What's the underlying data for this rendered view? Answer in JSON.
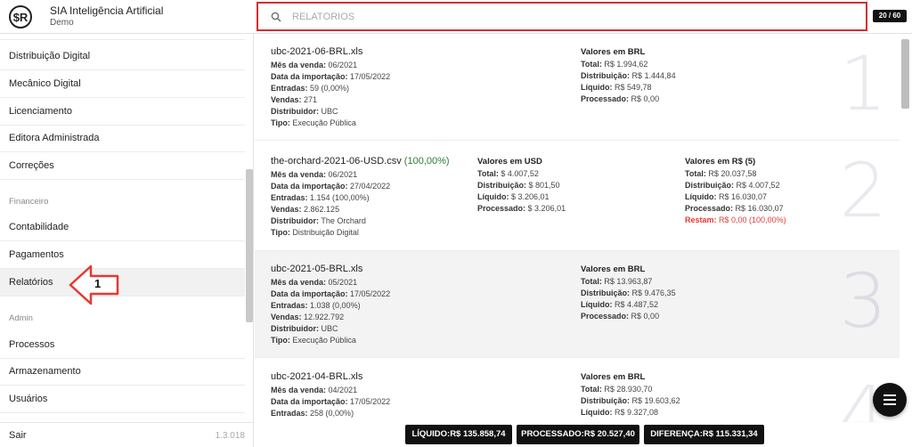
{
  "header": {
    "logo_text": "$R",
    "app_title": "SIA Inteligência Artificial",
    "app_subtitle": "Demo",
    "search_placeholder": "RELATÓRIOS",
    "page_counter": "20 / 60",
    "accent_color": "#d32f2f"
  },
  "sidebar": {
    "items": [
      {
        "label": "Distribuição Digital"
      },
      {
        "label": "Mecânico Digital"
      },
      {
        "label": "Licenciamento"
      },
      {
        "label": "Editora Administrada"
      },
      {
        "label": "Correções"
      }
    ],
    "section_financeiro": "Financeiro",
    "financeiro_items": [
      {
        "label": "Contabilidade"
      },
      {
        "label": "Pagamentos"
      },
      {
        "label": "Relatórios"
      }
    ],
    "section_admin": "Admin",
    "admin_items": [
      {
        "label": "Processos"
      },
      {
        "label": "Armazenamento"
      },
      {
        "label": "Usuários"
      }
    ],
    "logout_label": "Sair",
    "version": "1.3.018",
    "annotation_number": "1"
  },
  "reports": [
    {
      "file": "ubc-2021-06-BRL.xls",
      "file_pct": "",
      "mes": "06/2021",
      "importacao": "17/05/2022",
      "entradas": "59 (0,00%)",
      "vendas": "271",
      "distribuidor": "UBC",
      "tipo": "Execução Pública",
      "brl_title": "Valores em BRL",
      "brl_total": "R$ 1.994,62",
      "brl_distribuicao": "R$ 1.444,84",
      "brl_liquido": "R$ 549,78",
      "brl_processado": "R$ 0,00",
      "index": "1"
    },
    {
      "file": "the-orchard-2021-06-USD.csv",
      "file_pct": "(100,00%)",
      "mes": "06/2021",
      "importacao": "27/04/2022",
      "entradas": "1.154 (100,00%)",
      "vendas": "2.862.125",
      "distribuidor": "The Orchard",
      "tipo": "Distribuição Digital",
      "usd_title": "Valores em USD",
      "usd_total": "$ 4.007,52",
      "usd_distribuicao": "$ 801,50",
      "usd_liquido": "$ 3.206,01",
      "usd_processado": "$ 3.206,01",
      "rs_title": "Valores em R$ (5)",
      "rs_total": "R$ 20.037,58",
      "rs_distribuicao": "R$ 4.007,52",
      "rs_liquido": "R$ 16.030,07",
      "rs_processado": "R$ 16.030,07",
      "rs_restam": "R$ 0,00 (100,00%)",
      "index": "2"
    },
    {
      "file": "ubc-2021-05-BRL.xls",
      "file_pct": "",
      "mes": "05/2021",
      "importacao": "17/05/2022",
      "entradas": "1.038 (0,00%)",
      "vendas": "12.922.792",
      "distribuidor": "UBC",
      "tipo": "Execução Pública",
      "brl_title": "Valores em BRL",
      "brl_total": "R$ 13.963,87",
      "brl_distribuicao": "R$ 9.476,35",
      "brl_liquido": "R$ 4.487,52",
      "brl_processado": "R$ 0,00",
      "index": "3"
    },
    {
      "file": "ubc-2021-04-BRL.xls",
      "file_pct": "",
      "mes": "04/2021",
      "importacao": "17/05/2022",
      "entradas": "258 (0,00%)",
      "brl_title": "Valores em BRL",
      "brl_total": "R$ 28.930,70",
      "brl_distribuicao": "R$ 19.603,62",
      "brl_liquido": "R$ 9.327,08",
      "index": "4"
    }
  ],
  "labels": {
    "mes": "Mês da venda:",
    "importacao": "Data da importação:",
    "entradas": "Entradas:",
    "vendas": "Vendas:",
    "distribuidor": "Distribuidor:",
    "tipo": "Tipo:",
    "total": "Total:",
    "distribuicao": "Distribuição:",
    "liquido": "Líquido:",
    "processado": "Processado:",
    "restam": "Restam:"
  },
  "totals": {
    "liquido": "LÍQUIDO:R$ 135.858,74",
    "processado": "PROCESSADO:R$ 20.527,40",
    "diferenca": "DIFERENÇA:R$ 115.331,34"
  }
}
